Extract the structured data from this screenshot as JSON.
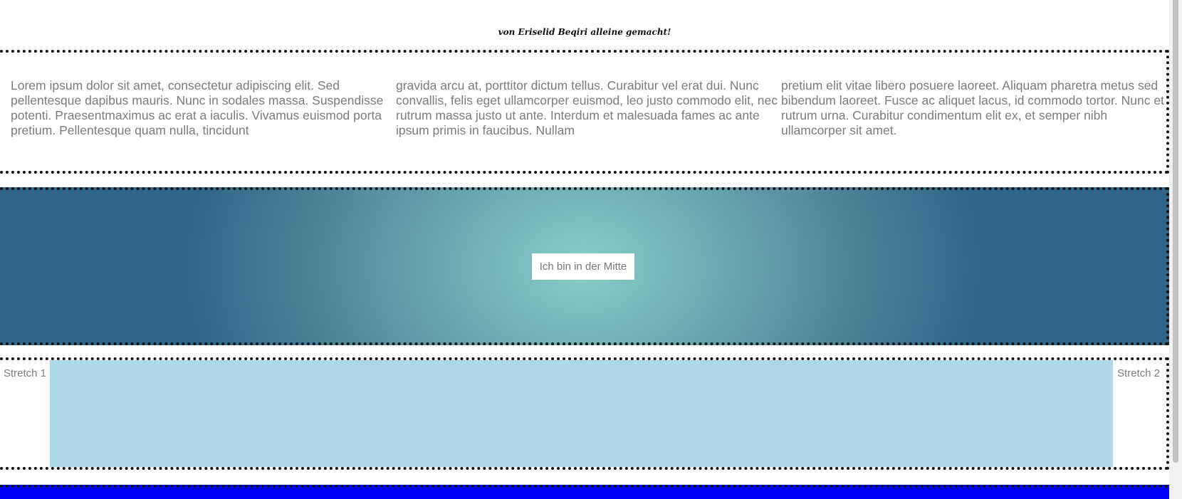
{
  "header": {
    "author_note": "von Eriselid Beqiri alleine gemacht!"
  },
  "text_section": {
    "columns": [
      "Lorem ipsum dolor sit amet, consectetur adipiscing elit. Sed pellentesque dapibus mauris. Nunc in sodales massa. Suspendisse potenti. Praesentmaximus ac erat a iaculis. Vivamus euismod porta pretium. Pellentesque quam nulla, tincidunt",
      "gravida arcu at, porttitor dictum tellus. Curabitur vel erat dui. Nunc convallis, felis eget ullamcorper euismod, leo justo commodo elit, nec rutrum massa justo ut ante. Interdum et malesuada fames ac ante ipsum primis in faucibus. Nullam",
      "pretium elit vitae libero posuere laoreet. Aliquam pharetra metus sed bibendum laoreet. Fusce ac aliquet lacus, id commodo tortor. Nunc et rutrum urna. Curabitur condimentum elit ex, et semper nibh ullamcorper sit amet."
    ]
  },
  "gradient_section": {
    "center_label": "Ich bin in der Mitte",
    "colors": {
      "center": "#86cfc8",
      "edge": "#30678a"
    }
  },
  "stretch_section": {
    "left_label": "Stretch 1",
    "right_label": "Stretch 2",
    "fill_color": "#add8e6"
  },
  "footer_bar": {
    "color": "#0000ff"
  }
}
